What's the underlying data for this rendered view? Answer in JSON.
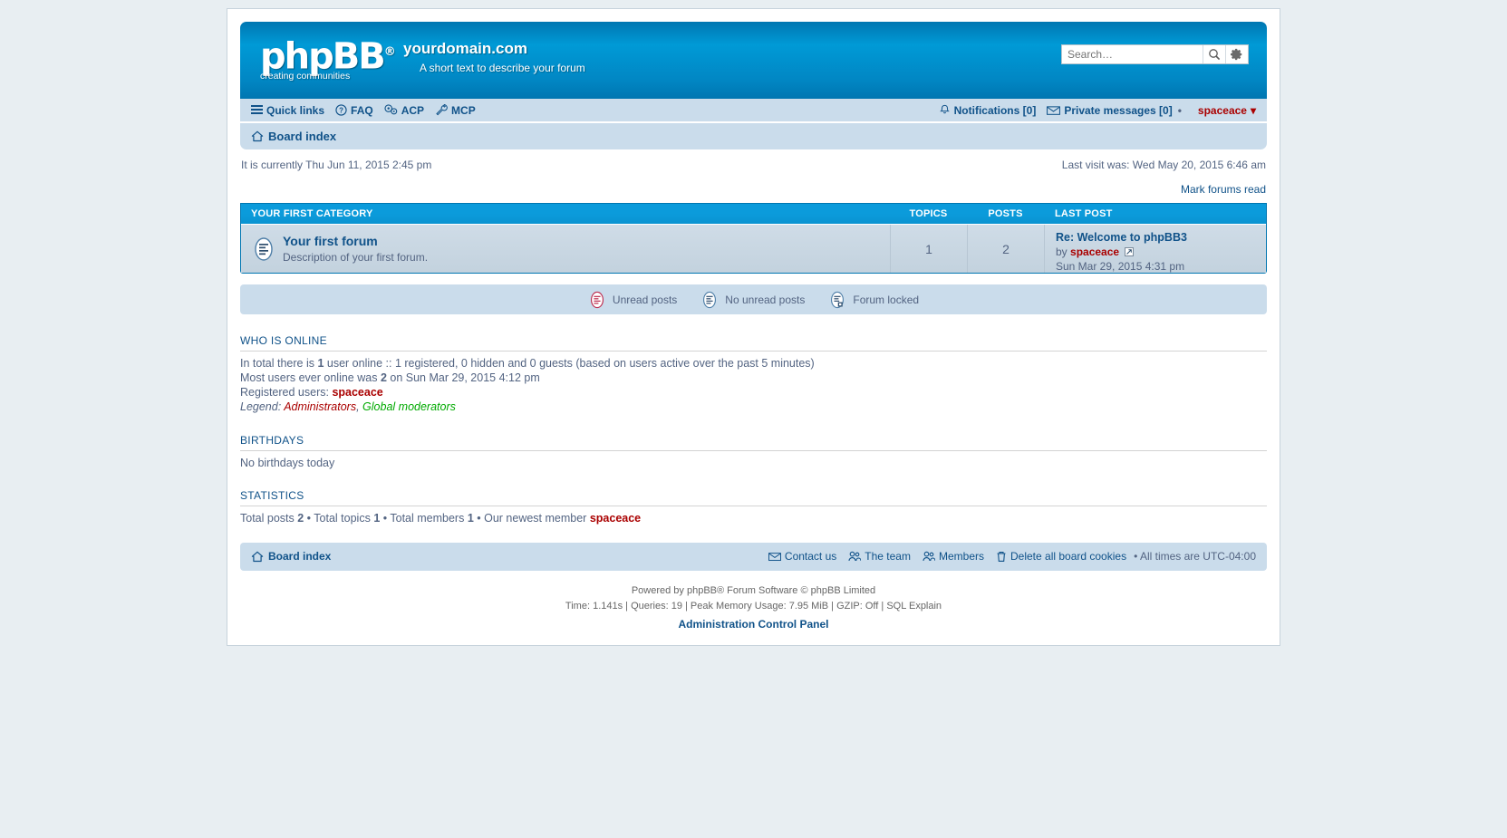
{
  "header": {
    "logo_text": "phpBB",
    "logo_reg": "®",
    "logo_tagline": "creating communities",
    "site_name": "yourdomain.com",
    "site_description": "A short text to describe your forum"
  },
  "search": {
    "value": "",
    "placeholder": "Search…",
    "search_icon": "magnifier-icon",
    "advanced_icon": "gear-icon"
  },
  "navbar": {
    "quick_links": "Quick links",
    "faq": "FAQ",
    "acp": "ACP",
    "mcp": "MCP",
    "notifications": "Notifications [0]",
    "private_messages": "Private messages [0]",
    "username": "spaceace",
    "user_caret": "▾",
    "separator": "•"
  },
  "breadcrumb": {
    "board_index": "Board index"
  },
  "info": {
    "current_time": "It is currently Thu Jun 11, 2015 2:45 pm",
    "last_visit": "Last visit was: Wed May 20, 2015 6:46 am",
    "mark_forums_read": "Mark forums read"
  },
  "forum_table": {
    "category": "YOUR FIRST CATEGORY",
    "col_topics": "TOPICS",
    "col_posts": "POSTS",
    "col_lastpost": "LAST POST",
    "rows": [
      {
        "name": "Your first forum",
        "description": "Description of your first forum.",
        "topics": "1",
        "posts": "2",
        "last_post_title": "Re: Welcome to phpBB3",
        "last_post_by_label": "by",
        "last_post_author": "spaceace",
        "last_post_date": "Sun Mar 29, 2015 4:31 pm"
      }
    ]
  },
  "legend": {
    "unread": "Unread posts",
    "no_unread": "No unread posts",
    "locked": "Forum locked"
  },
  "who_is_online": {
    "title": "WHO IS ONLINE",
    "total_prefix": "In total there is ",
    "total_count": "1",
    "total_suffix": " user online :: 1 registered, 0 hidden and 0 guests (based on users active over the past 5 minutes)",
    "most_prefix": "Most users ever online was ",
    "most_count": "2",
    "most_suffix": " on Sun Mar 29, 2015 4:12 pm",
    "registered_label": "Registered users: ",
    "registered_users": "spaceace",
    "legend_label": "Legend: ",
    "legend_admins": "Administrators",
    "legend_comma": ", ",
    "legend_gmods": "Global moderators"
  },
  "birthdays": {
    "title": "BIRTHDAYS",
    "text": "No birthdays today"
  },
  "statistics": {
    "title": "STATISTICS",
    "total_posts_label": "Total posts ",
    "total_posts": "2",
    "sep1": " • ",
    "total_topics_label": "Total topics ",
    "total_topics": "1",
    "sep2": " • ",
    "total_members_label": "Total members ",
    "total_members": "1",
    "sep3": " • ",
    "newest_label": "Our newest member ",
    "newest_member": "spaceace"
  },
  "footer": {
    "board_index": "Board index",
    "contact_us": "Contact us",
    "the_team": "The team",
    "members": "Members",
    "delete_cookies": "Delete all board cookies",
    "bullet": "•",
    "timezone": "All times are UTC-04:00",
    "powered_by": "Powered by phpBB® Forum Software © phpBB Limited",
    "stats_line": "Time: 1.141s | Queries: 19 | Peak Memory Usage: 7.95 MiB | GZIP: Off | SQL Explain",
    "acp_link": "Administration Control Panel"
  },
  "colors": {
    "brand_blue": "#0b9bdb",
    "header_blue": "#0076b1",
    "nav_blue": "#cadceb",
    "link": "#105289",
    "text": "#536482",
    "admin_red": "#aa0000",
    "gmod_green": "#00aa00"
  }
}
